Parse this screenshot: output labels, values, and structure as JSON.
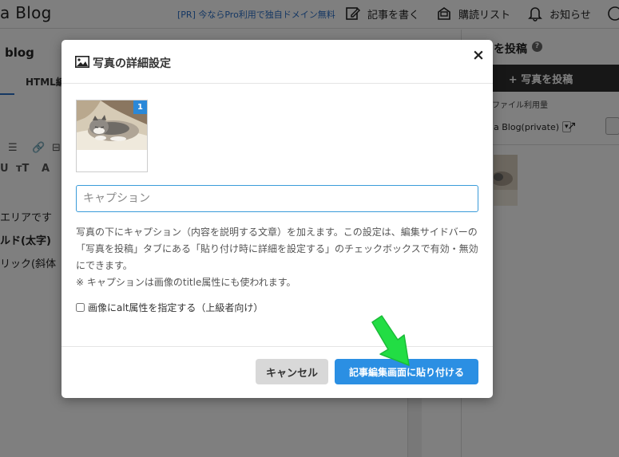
{
  "topbar": {
    "brand": "a Blog",
    "promo": "[PR] 今ならPro利用で独自ドメイン無料",
    "write_label": "記事を書く",
    "subscribe_label": "購読リスト",
    "notify_label": "お知らせ"
  },
  "editor": {
    "blog_title": "blog",
    "html_tab": "HTML編",
    "lines": [
      "エリアです",
      "ルド(太字)",
      "リック(斜体"
    ]
  },
  "sidebar": {
    "title": "を投稿",
    "help": "?",
    "post_button": "+ 写真を投稿",
    "usage": "ファイル利用量",
    "select_value": "a Blog(private)"
  },
  "modal": {
    "title": "写真の詳細設定",
    "close": "×",
    "badge": "1",
    "caption_placeholder": "キャプション",
    "desc1": "写真の下にキャプション（内容を説明する文章）を加えます。この設定は、編集サイドバーの「写真を投稿」タブにある「貼り付け時に詳細を設定する」のチェックボックスで有効・無効にできます。",
    "desc2": "※ キャプションは画像のtitle属性にも使われます。",
    "alt_label": "画像にalt属性を指定する（上級者向け）",
    "cancel_label": "キャンセル",
    "paste_label": "記事編集画面に貼り付ける"
  },
  "colors": {
    "accent": "#2b8fe3",
    "arrow": "#22dd44"
  }
}
